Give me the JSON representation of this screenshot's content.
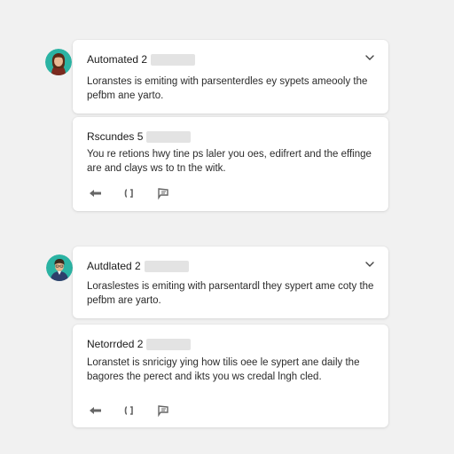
{
  "threads": [
    {
      "comment": {
        "author": "Automated 2",
        "body_line1": "Loranstes is emiting with parsenterdles ey sypets ameooly the",
        "body_line2": "pefbm ane yarto."
      },
      "reply": {
        "author": "Rscundes 5",
        "body_line1": "You re retions hwy tine ps laler you oes, edifrert and the effinge",
        "body_line2": "are and clays ws to tn the witk."
      }
    },
    {
      "comment": {
        "author": "Autdlated 2",
        "body_line1": "Loraslestes is emiting with parsentardl they sypert ame coty the",
        "body_line2": "pefbm are yarto."
      },
      "reply": {
        "author": "Netorrded 2",
        "body_line1": "Loranstet is snricigy ying how tilis oee le sypert ane daily the",
        "body_line2": "bagores the perect and ikts you ws credal lngh cled."
      }
    }
  ],
  "icons": {
    "expand": "chevron-down-icon",
    "reply": "reply-arrow-icon",
    "share": "share-icon",
    "flag": "flag-icon"
  },
  "colors": {
    "background": "#f1f1f1",
    "card": "#ffffff",
    "avatar_bg": "#2bb3a3"
  }
}
